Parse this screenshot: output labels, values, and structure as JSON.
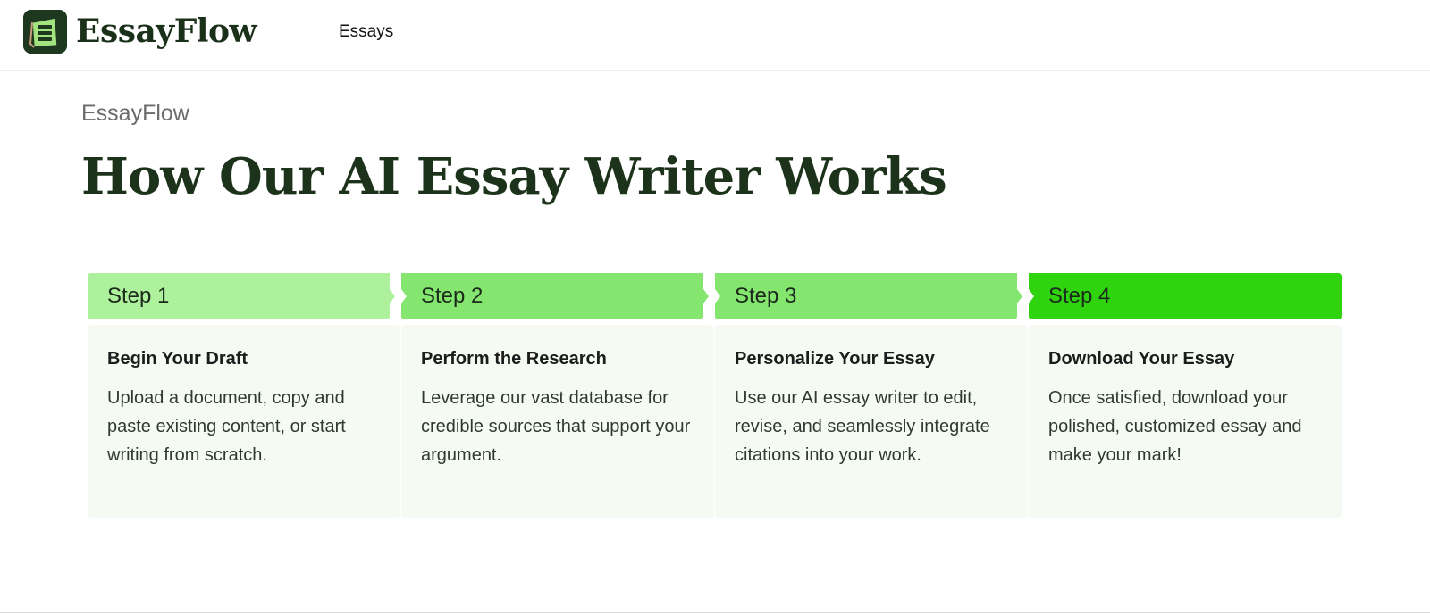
{
  "header": {
    "brand": "EssayFlow",
    "nav": [
      {
        "label": "Essays"
      }
    ]
  },
  "hero": {
    "eyebrow": "EssayFlow",
    "title": "How Our AI Essay Writer Works"
  },
  "steps": [
    {
      "label": "Step 1",
      "title": "Begin Your Draft",
      "description": "Upload a document, copy and paste existing content, or start writing from scratch.",
      "color": "#adf19c"
    },
    {
      "label": "Step 2",
      "title": "Perform the Research",
      "description": "Leverage our vast database for credible sources that support your argument.",
      "color": "#84e66e"
    },
    {
      "label": "Step 3",
      "title": "Personalize Your Essay",
      "description": "Use our AI essay writer to edit, revise, and seamlessly integrate citations into your work.",
      "color": "#84e66e"
    },
    {
      "label": "Step 4",
      "title": "Download Your Essay",
      "description": "Once satisfied, download your polished, customized essay and make your mark!",
      "color": "#2fd40f"
    }
  ],
  "colors": {
    "brand_dark": "#1e3820",
    "title_text": "#1d321b",
    "card_background": "#f5fbf3"
  }
}
